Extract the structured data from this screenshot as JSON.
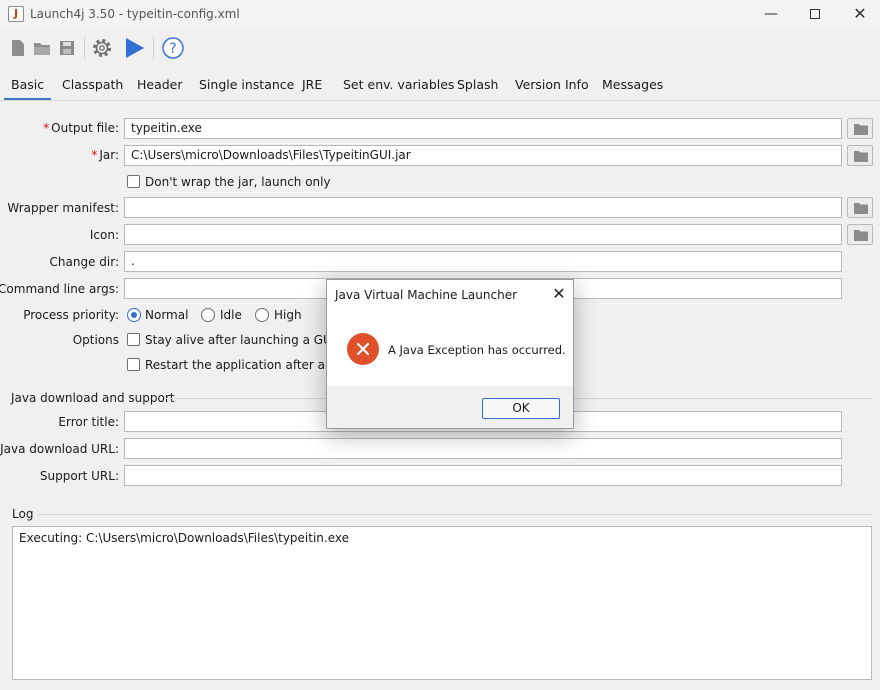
{
  "window": {
    "title": "Launch4j 3.50 - typeitin-config.xml"
  },
  "toolbar": {
    "icons": [
      "new-file-icon",
      "open-folder-icon",
      "save-icon",
      "gear-icon",
      "play-icon",
      "help-icon"
    ]
  },
  "tabs": [
    "Basic",
    "Classpath",
    "Header",
    "Single instance",
    "JRE",
    "Set env. variables",
    "Splash",
    "Version Info",
    "Messages"
  ],
  "basic": {
    "output_file_label": "Output file:",
    "output_file_value": "typeitin.exe",
    "jar_label": "Jar:",
    "jar_value": "C:\\Users\\micro\\Downloads\\Files\\TypeitinGUI.jar",
    "dont_wrap_label": "Don't wrap the jar, launch only",
    "wrapper_manifest_label": "Wrapper manifest:",
    "wrapper_manifest_value": "",
    "icon_label": "Icon:",
    "icon_value": "",
    "change_dir_label": "Change dir:",
    "change_dir_value": ".",
    "cmd_args_label": "Command line args:",
    "cmd_args_value": "",
    "priority_label": "Process priority:",
    "priority_options": [
      "Normal",
      "Idle",
      "High"
    ],
    "priority_selected": "Normal",
    "options_label": "Options",
    "stay_alive_label": "Stay alive after launching a GUI app",
    "restart_label": "Restart the application after a crash"
  },
  "java_download": {
    "section_title": "Java download and support",
    "error_title_label": "Error title:",
    "error_title_value": "",
    "download_url_label": "Java download URL:",
    "download_url_value": "",
    "support_url_label": "Support URL:",
    "support_url_value": ""
  },
  "log": {
    "section_title": "Log",
    "text": "Executing: C:\\Users\\micro\\Downloads\\Files\\typeitin.exe"
  },
  "dialog": {
    "title": "Java Virtual Machine Launcher",
    "message": "A Java Exception has occurred.",
    "ok_label": "OK",
    "icon": "error-icon",
    "icon_color": "#e0502a"
  },
  "colors": {
    "accent": "#2f6fd6",
    "required": "#d01010"
  }
}
